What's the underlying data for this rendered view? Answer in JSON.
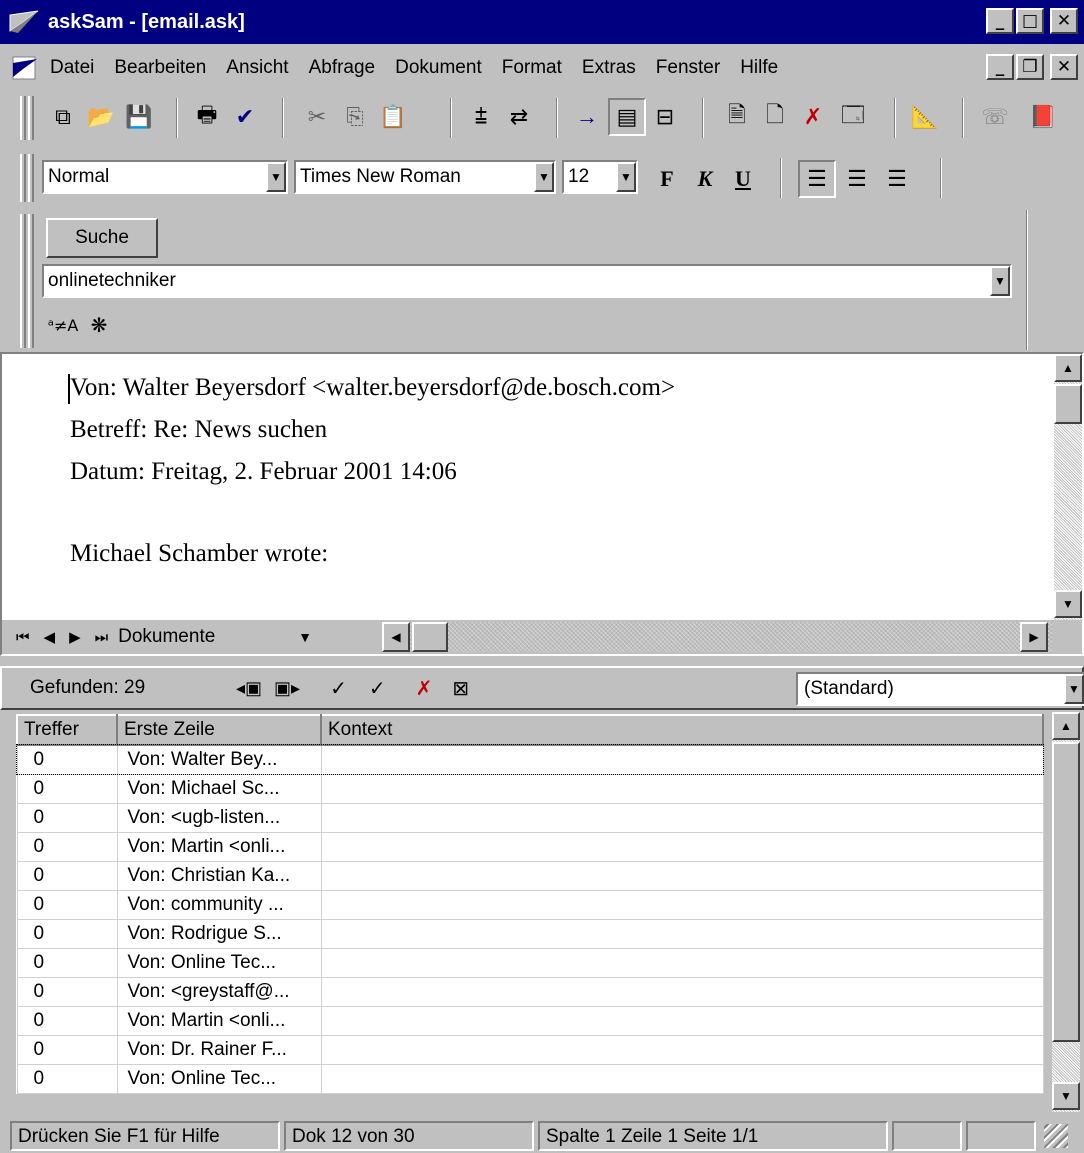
{
  "window": {
    "title": "askSam - [email.ask]"
  },
  "menu": [
    "Datei",
    "Bearbeiten",
    "Ansicht",
    "Abfrage",
    "Dokument",
    "Format",
    "Extras",
    "Fenster",
    "Hilfe"
  ],
  "format_toolbar": {
    "style": "Normal",
    "font": "Times New Roman",
    "size": "12",
    "bold": "F",
    "italic": "K",
    "underline": "U"
  },
  "search": {
    "button": "Suche",
    "query": "onlinetechniker"
  },
  "document": {
    "lines": [
      "Von: Walter Beyersdorf <walter.beyersdorf@de.bosch.com>",
      "Betreff: Re: News suchen",
      "Datum: Freitag, 2. Februar 2001 14:06",
      "",
      "Michael Schamber wrote:"
    ],
    "nav_label": "Dokumente"
  },
  "results": {
    "found_label": "Gefunden: 29",
    "view": "(Standard)",
    "columns": [
      "Treffer",
      "Erste Zeile",
      "Kontext"
    ],
    "rows": [
      {
        "hits": "0",
        "first": "Von: Walter Bey...",
        "context": ""
      },
      {
        "hits": "0",
        "first": "Von: Michael Sc...",
        "context": ""
      },
      {
        "hits": "0",
        "first": "Von: <ugb-listen...",
        "context": ""
      },
      {
        "hits": "0",
        "first": "Von: Martin <onli...",
        "context": ""
      },
      {
        "hits": "0",
        "first": "Von: Christian Ka...",
        "context": ""
      },
      {
        "hits": "0",
        "first": "Von: community ...",
        "context": ""
      },
      {
        "hits": "0",
        "first": "Von: Rodrigue S...",
        "context": ""
      },
      {
        "hits": "0",
        "first": "Von: Online Tec...",
        "context": ""
      },
      {
        "hits": "0",
        "first": "Von: <greystaff@...",
        "context": ""
      },
      {
        "hits": "0",
        "first": "Von: Martin <onli...",
        "context": ""
      },
      {
        "hits": "0",
        "first": "Von: Dr. Rainer F...",
        "context": ""
      },
      {
        "hits": "0",
        "first": "Von: Online Tec...",
        "context": ""
      }
    ]
  },
  "status": {
    "help": "Drücken Sie F1 für Hilfe",
    "doc": "Dok 12 von 30",
    "position": "Spalte 1  Zeile 1  Seite 1/1"
  },
  "colors": {
    "titlebar": "#000080",
    "face": "#c0c0c0"
  }
}
